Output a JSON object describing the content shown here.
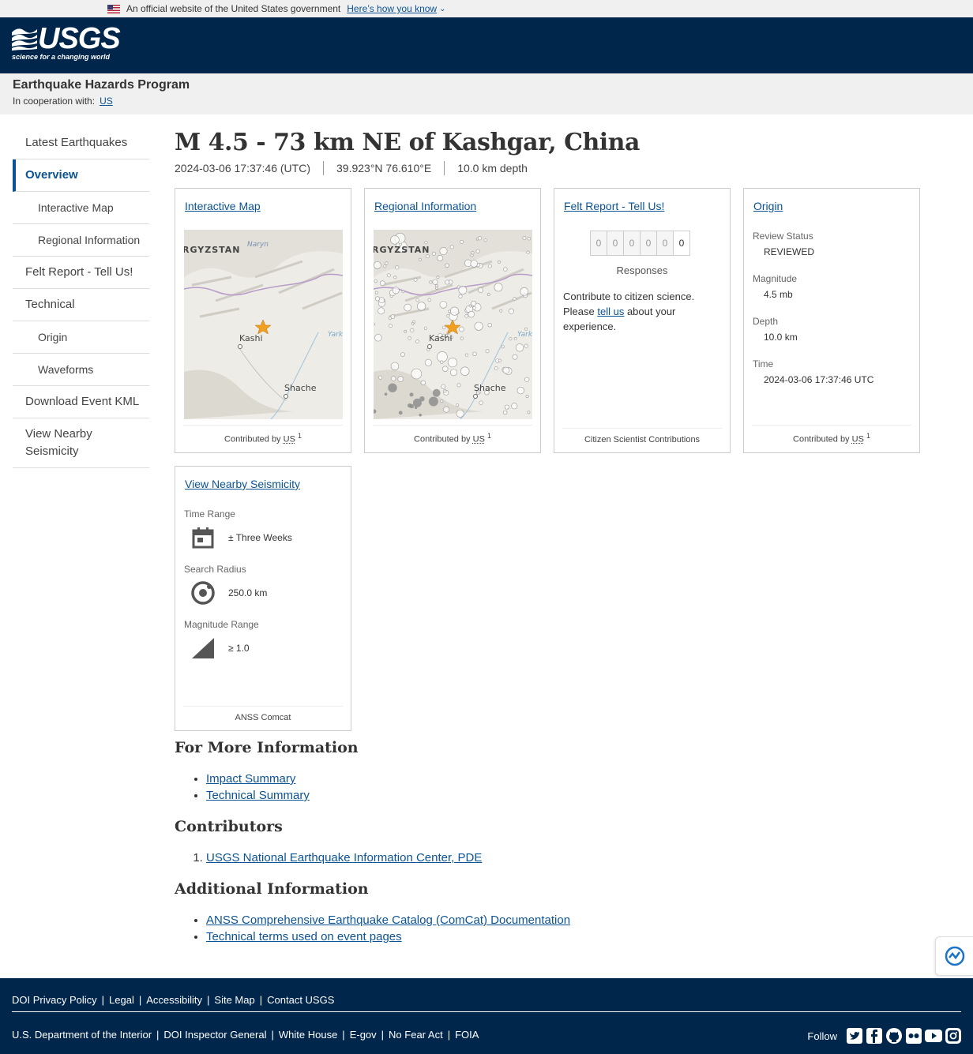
{
  "gov_banner": {
    "text": "An official website of the United States government",
    "link": "Here’s how you know"
  },
  "header": {
    "logo_word": "USGS",
    "logo_tagline": "science for a changing world"
  },
  "program": {
    "title": "Earthquake Hazards Program",
    "coop_label": "In cooperation with:",
    "coop_link": "US"
  },
  "sidebar": {
    "items": [
      {
        "label": "Latest Earthquakes"
      },
      {
        "label": "Overview"
      },
      {
        "label": "Interactive Map"
      },
      {
        "label": "Regional Information"
      },
      {
        "label": "Felt Report - Tell Us!"
      },
      {
        "label": "Technical"
      },
      {
        "label": "Origin"
      },
      {
        "label": "Waveforms"
      },
      {
        "label": "Download Event KML"
      },
      {
        "label": "View Nearby Seismicity"
      }
    ]
  },
  "event": {
    "title": "M 4.5 - 73 km NE of Kashgar, China",
    "time": "2024-03-06 17:37:46 (UTC)",
    "location": "39.923°N 76.610°E",
    "depth": "10.0 km depth"
  },
  "cards": {
    "interactive_map": {
      "title": "Interactive Map",
      "foot_prefix": "Contributed by ",
      "foot_source": "US",
      "foot_ref": "1"
    },
    "regional": {
      "title": "Regional Information",
      "foot_prefix": "Contributed by ",
      "foot_source": "US",
      "foot_ref": "1"
    },
    "map_labels": {
      "country": "RGYZSTAN",
      "city1": "Kashi",
      "city2": "Shache",
      "river": "Yark",
      "region": "Naryn"
    },
    "felt": {
      "title": "Felt Report - Tell Us!",
      "digits": [
        "0",
        "0",
        "0",
        "0",
        "0",
        "0"
      ],
      "responses_label": "Responses",
      "text_before": "Contribute to citizen science. Please ",
      "link": "tell us",
      "text_after": " about your experience.",
      "foot": "Citizen Scientist Contributions"
    },
    "origin": {
      "title": "Origin",
      "review_label": "Review Status",
      "review_value": "REVIEWED",
      "magnitude_label": "Magnitude",
      "magnitude_value": "4.5 mb",
      "depth_label": "Depth",
      "depth_value": "10.0 km",
      "time_label": "Time",
      "time_value": "2024-03-06 17:37:46 UTC",
      "foot_prefix": "Contributed by ",
      "foot_source": "US",
      "foot_ref": "1"
    },
    "seismicity": {
      "title": "View Nearby Seismicity",
      "time_label": "Time Range",
      "time_value": "± Three Weeks",
      "radius_label": "Search Radius",
      "radius_value": "250.0 km",
      "mag_label": "Magnitude Range",
      "mag_value": "≥ 1.0",
      "foot": "ANSS Comcat"
    }
  },
  "more_info": {
    "heading": "For More Information",
    "links": [
      "Impact Summary",
      "Technical Summary"
    ]
  },
  "contributors": {
    "heading": "Contributors",
    "items": [
      "USGS National Earthquake Information Center, PDE"
    ]
  },
  "additional": {
    "heading": "Additional Information",
    "links": [
      "ANSS Comprehensive Earthquake Catalog (ComCat) Documentation",
      "Technical terms used on event pages"
    ]
  },
  "footer": {
    "row1": [
      "DOI Privacy Policy",
      "Legal",
      "Accessibility",
      "Site Map",
      "Contact USGS"
    ],
    "row2": [
      "U.S. Department of the Interior",
      "DOI Inspector General",
      "White House",
      "E-gov",
      "No Fear Act",
      "FOIA"
    ],
    "follow_label": "Follow",
    "social_icons": [
      "twitter-icon",
      "facebook-icon",
      "github-icon",
      "flickr-icon",
      "youtube-icon",
      "instagram-icon"
    ]
  },
  "colors": {
    "header_bg": "#00264c",
    "link": "#0b5394",
    "accent_star": "#f0a020"
  }
}
